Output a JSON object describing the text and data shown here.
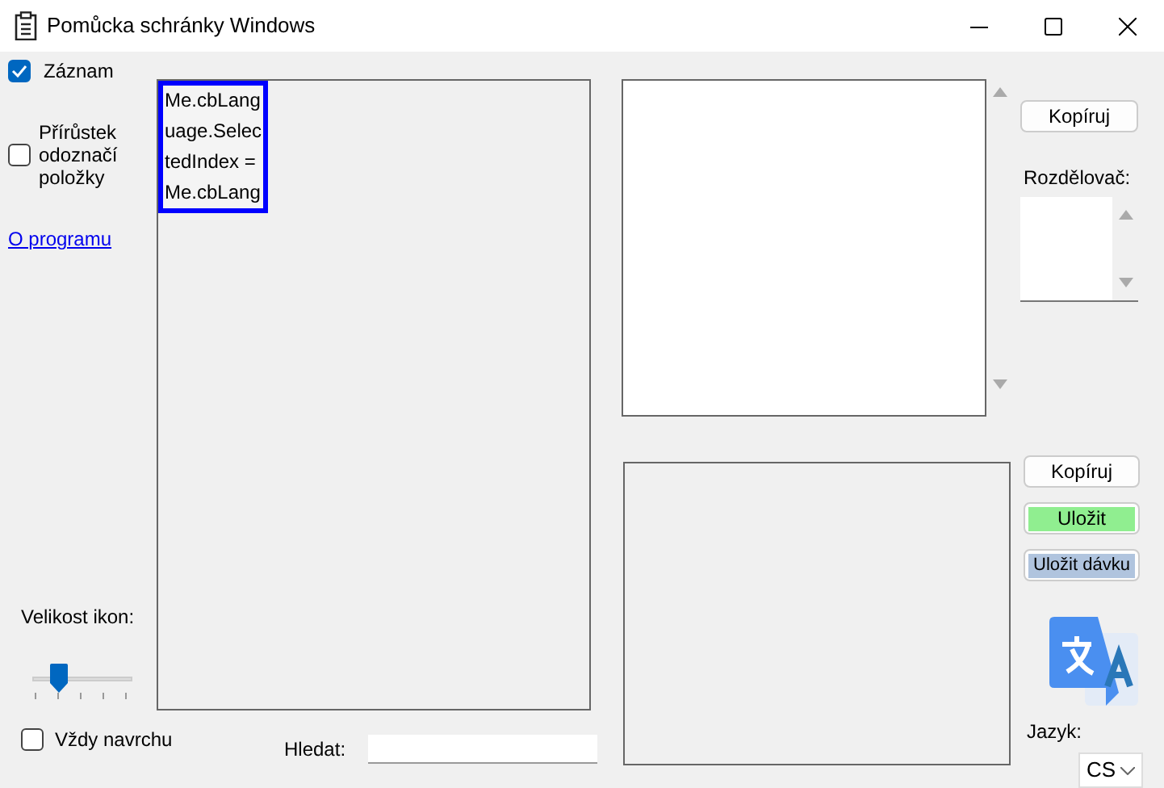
{
  "window": {
    "title": "Pomůcka schránky Windows"
  },
  "left": {
    "record": {
      "label": "Záznam",
      "checked": true
    },
    "increment": {
      "label": "Přírůstek odoznačí položky",
      "checked": false
    },
    "about_link": "O programu",
    "icon_size": {
      "label": "Velikost ikon:",
      "level": 0.25
    },
    "always_on_top": {
      "label": "Vždy navrchu",
      "checked": false
    }
  },
  "clipboard_text": {
    "selected_lines": [
      "Me.cbLang",
      "uage.Selec",
      "tedIndex =",
      "Me.cbLang"
    ]
  },
  "search": {
    "label": "Hledat:"
  },
  "copy_button": "Kopíruj",
  "separator": {
    "label": "Rozdělovač:"
  },
  "buttons": [
    {
      "label": "Kopíruj",
      "kind": "plain"
    },
    {
      "label": "Uložit",
      "kind": "save"
    },
    {
      "label": "Uložit dávku",
      "kind": "batch"
    }
  ],
  "language": {
    "label": "Jazyk:",
    "value": "CS"
  }
}
